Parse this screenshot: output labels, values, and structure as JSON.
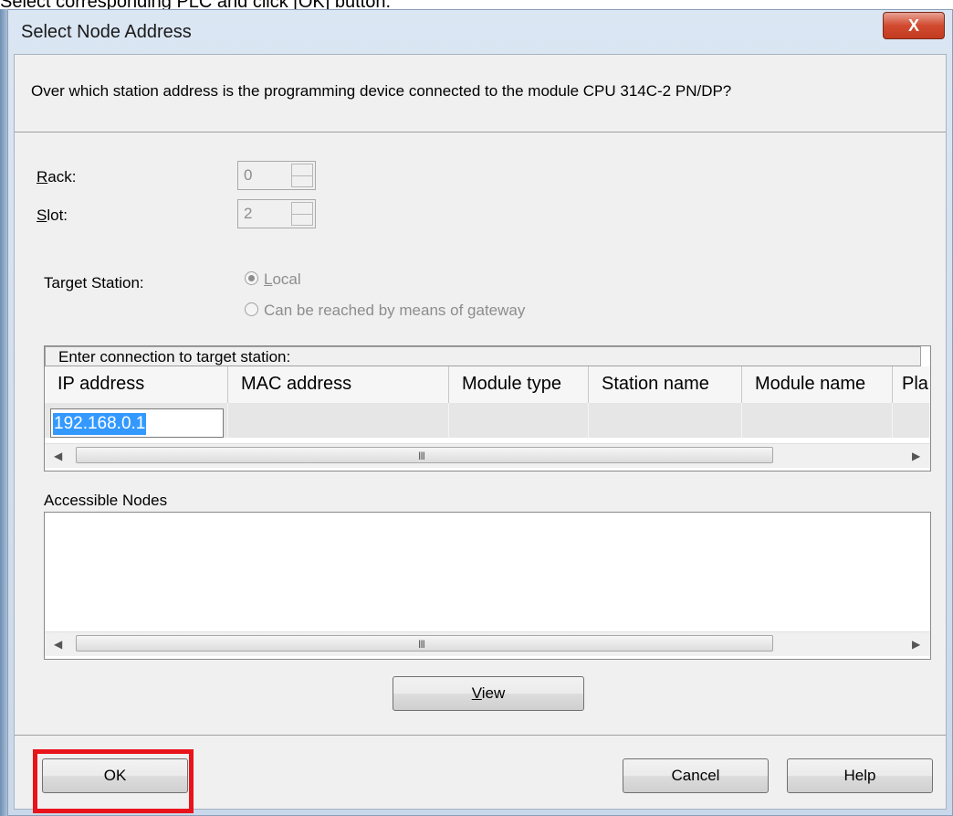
{
  "caption": "Select corresponding PLC and click [OK] button.",
  "window": {
    "title": "Select Node Address",
    "close_label": "X"
  },
  "question": "Over which station address is the programming device connected to the module CPU 314C-2 PN/DP?",
  "fields": {
    "rack_label_u": "R",
    "rack_label_rest": "ack:",
    "rack_value": "0",
    "slot_label_u": "S",
    "slot_label_rest": "lot:",
    "slot_value": "2"
  },
  "target_station": {
    "label": "Target Station:",
    "local_u": "L",
    "local_rest": "ocal",
    "local_checked": true,
    "gateway_pre": "Can be reached by means of ",
    "gateway_u": "g",
    "gateway_post": "ateway",
    "gateway_checked": false
  },
  "connection_grid": {
    "caption": "Enter connection to target station:",
    "columns": [
      "IP address",
      "MAC address",
      "Module type",
      "Station name",
      "Module name",
      "Pla"
    ],
    "rows": [
      {
        "ip": "192.168.0.1",
        "mac": "",
        "module_type": "",
        "station_name": "",
        "module_name": "",
        "pla": ""
      }
    ],
    "scroll_grip": "III"
  },
  "accessible_nodes": {
    "label": "Accessible Nodes",
    "items": [],
    "scroll_grip": "III"
  },
  "buttons": {
    "view_u": "V",
    "view_rest": "iew",
    "ok": "OK",
    "cancel": "Cancel",
    "help": "Help"
  },
  "colors": {
    "highlight": "#e8141b",
    "selection": "#3399ff",
    "close_button": "#d24a2f"
  },
  "icons": {
    "close": "close-icon",
    "scroll_left": "left-arrow-icon",
    "scroll_right": "right-arrow-icon",
    "spin": "spin-arrows-icon"
  }
}
